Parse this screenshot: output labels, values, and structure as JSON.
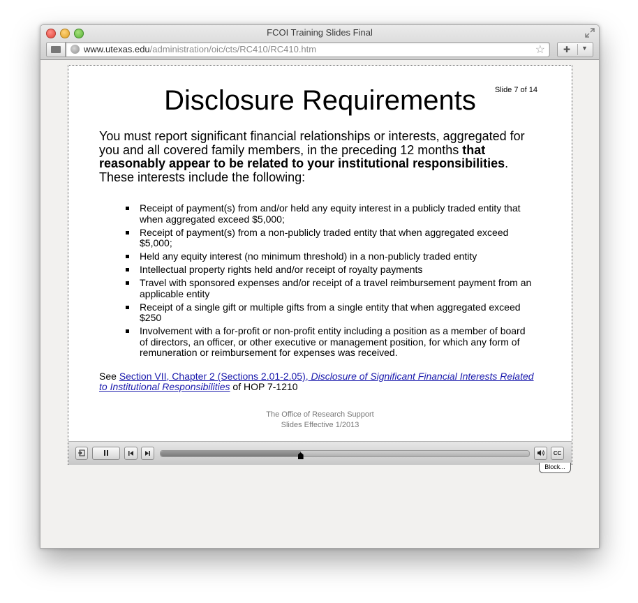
{
  "window": {
    "title": "FCOI Training Slides Final"
  },
  "address_bar": {
    "host": "www.utexas.edu",
    "path": "/administration/oic/cts/RC410/RC410.htm"
  },
  "icons": {
    "close": "close-dot-icon",
    "minimize": "minimize-dot-icon",
    "zoom": "zoom-dot-icon",
    "fullscreen": "fullscreen-arrows-icon",
    "sidebar": "sidebar-grid-icon",
    "globe": "globe-icon",
    "bookmark": "star-icon",
    "extensions": "puzzle-icon",
    "menu": "chevron-down-icon",
    "exit": "exit-icon",
    "pause": "pause-icon",
    "prev": "skip-back-icon",
    "next": "skip-forward-icon",
    "volume": "speaker-icon",
    "captions": "cc-icon"
  },
  "slide": {
    "counter": "Slide 7 of 14",
    "title": "Disclosure Requirements",
    "intro_part1": "You must report significant financial relationships or interests, aggregated for you and all covered family members, in the preceding 12 months ",
    "intro_bold": "that reasonably appear to be related to your institutional responsibilities",
    "intro_part2": ". These interests include the following:",
    "bullets": [
      "Receipt of payment(s) from and/or held any equity interest in a publicly traded entity that when aggregated exceed $5,000;",
      "Receipt of payment(s) from a non-publicly traded entity that when aggregated exceed $5,000;",
      "Held any equity interest (no minimum threshold) in a non-publicly traded entity",
      "Intellectual property rights held and/or receipt of royalty payments",
      "Travel with sponsored expenses and/or receipt of a travel reimbursement payment from an applicable entity",
      "Receipt of a single gift or multiple gifts from a single entity that  when aggregated exceed $250",
      "Involvement with a for-profit or non-profit entity including a position as a member of board of directors, an officer, or other executive or management position, for which any form of remuneration or reimbursement for expenses was received."
    ],
    "see_prefix": "See ",
    "see_link_plain": "Section VII, Chapter 2 (Sections 2.01-2.05), ",
    "see_link_italic": "Disclosure of Significant Financial Interests Related to Institutional Responsibilities",
    "see_suffix": " of HOP 7-1210",
    "footer_line1": "The Office of Research Support",
    "footer_line2": "Slides Effective 1/2013"
  },
  "player": {
    "progress": 0.38,
    "captions_label": "CC",
    "block_tab_label": "Block..."
  }
}
